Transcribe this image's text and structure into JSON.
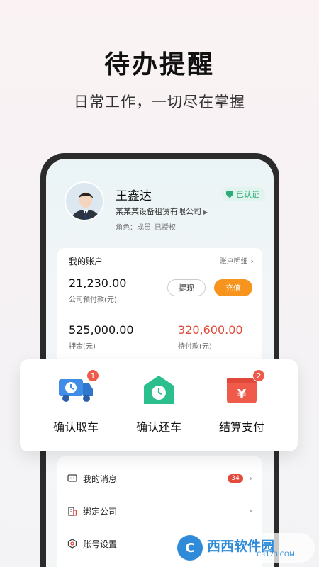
{
  "promo": {
    "title": "待办提醒",
    "subtitle": "日常工作，一切尽在掌握"
  },
  "profile": {
    "name": "王鑫达",
    "company": "某某某设备租赁有限公司",
    "role": "角色：成员–已授权",
    "verified_label": "已认证"
  },
  "account": {
    "title": "我的账户",
    "detail_link": "账户明细",
    "prepay_value": "21,230.00",
    "prepay_label": "公司预付款(元)",
    "withdraw_label": "提现",
    "recharge_label": "充值",
    "deposit_value": "525,000.00",
    "deposit_label": "押金(元)",
    "pending_value": "320,600.00",
    "pending_label": "待付款(元)"
  },
  "actions": [
    {
      "label": "确认取车",
      "badge": "1",
      "icon": "truck-clock-icon"
    },
    {
      "label": "确认还车",
      "badge": "",
      "icon": "house-clock-icon"
    },
    {
      "label": "结算支付",
      "badge": "2",
      "icon": "yen-wallet-icon"
    }
  ],
  "menu": [
    {
      "label": "我的消息",
      "badge": "34",
      "icon": "message-icon"
    },
    {
      "label": "绑定公司",
      "badge": "",
      "icon": "building-icon"
    },
    {
      "label": "账号设置",
      "badge": "",
      "icon": "settings-icon"
    }
  ],
  "watermark": {
    "name": "西西软件园",
    "url": "CR173.COM"
  },
  "colors": {
    "accent_orange": "#f7941d",
    "badge_red": "#f05a4a",
    "pending_red": "#e24a3b",
    "verified_green": "#2bab7a",
    "truck_blue": "#3f8de6",
    "house_green": "#2bbf8e"
  }
}
